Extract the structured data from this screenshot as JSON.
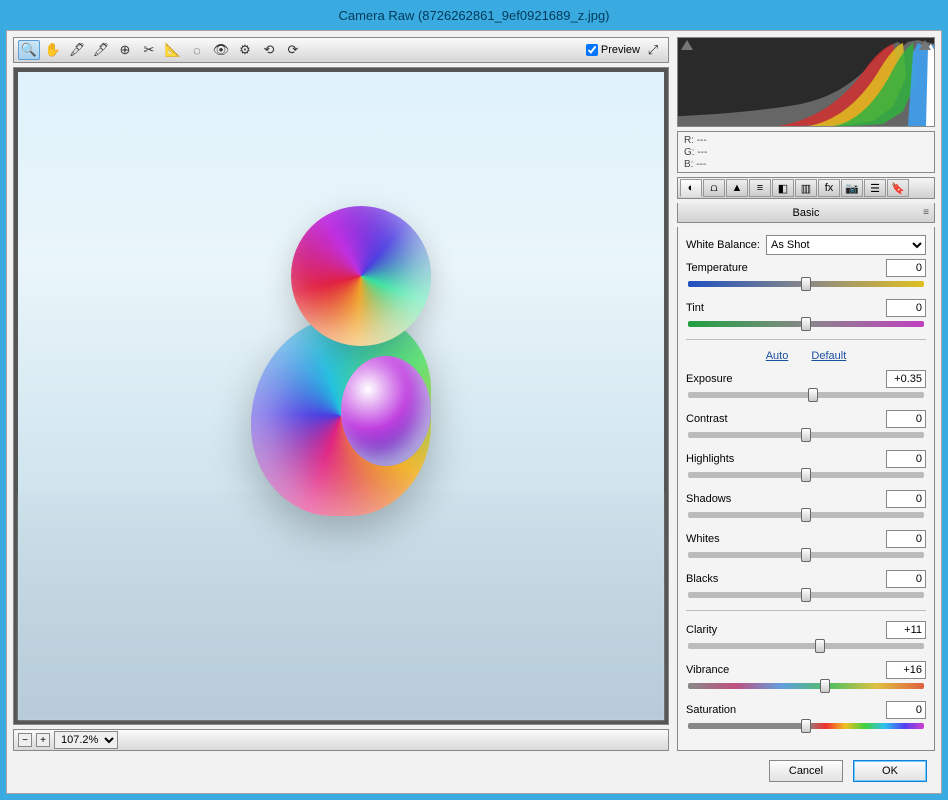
{
  "window": {
    "title": "Camera Raw (8726262861_9ef0921689_z.jpg)"
  },
  "toolbar": {
    "icons": [
      "zoom",
      "hand",
      "eyedrop-wb",
      "color-sampler",
      "target-adjust",
      "crop",
      "straighten",
      "spot-removal",
      "redeye",
      "adjust-brush",
      "grad-filter",
      "radial-filter",
      "rotate-ccw",
      "rotate-cw"
    ],
    "preview_label": "Preview",
    "preview_checked": true
  },
  "zoom": {
    "value": "107.2%"
  },
  "rgb": {
    "r": "R:  ---",
    "g": "G:  ---",
    "b": "B:  ---"
  },
  "tabs": [
    "basic",
    "curve",
    "detail",
    "hsl",
    "split",
    "lens",
    "fx",
    "calib",
    "presets",
    "snapshot"
  ],
  "panel": {
    "title": "Basic",
    "wb_label": "White Balance:",
    "wb_value": "As Shot",
    "auto": "Auto",
    "default": "Default",
    "sliders": {
      "temperature": {
        "label": "Temperature",
        "value": "0",
        "pos": 50,
        "track": "temp"
      },
      "tint": {
        "label": "Tint",
        "value": "0",
        "pos": 50,
        "track": "tint"
      },
      "exposure": {
        "label": "Exposure",
        "value": "+0.35",
        "pos": 53
      },
      "contrast": {
        "label": "Contrast",
        "value": "0",
        "pos": 50
      },
      "highlights": {
        "label": "Highlights",
        "value": "0",
        "pos": 50
      },
      "shadows": {
        "label": "Shadows",
        "value": "0",
        "pos": 50
      },
      "whites": {
        "label": "Whites",
        "value": "0",
        "pos": 50
      },
      "blacks": {
        "label": "Blacks",
        "value": "0",
        "pos": 50
      },
      "clarity": {
        "label": "Clarity",
        "value": "+11",
        "pos": 56
      },
      "vibrance": {
        "label": "Vibrance",
        "value": "+16",
        "pos": 58,
        "track": "vib"
      },
      "saturation": {
        "label": "Saturation",
        "value": "0",
        "pos": 50,
        "track": "sat"
      }
    }
  },
  "footer": {
    "cancel": "Cancel",
    "ok": "OK"
  }
}
